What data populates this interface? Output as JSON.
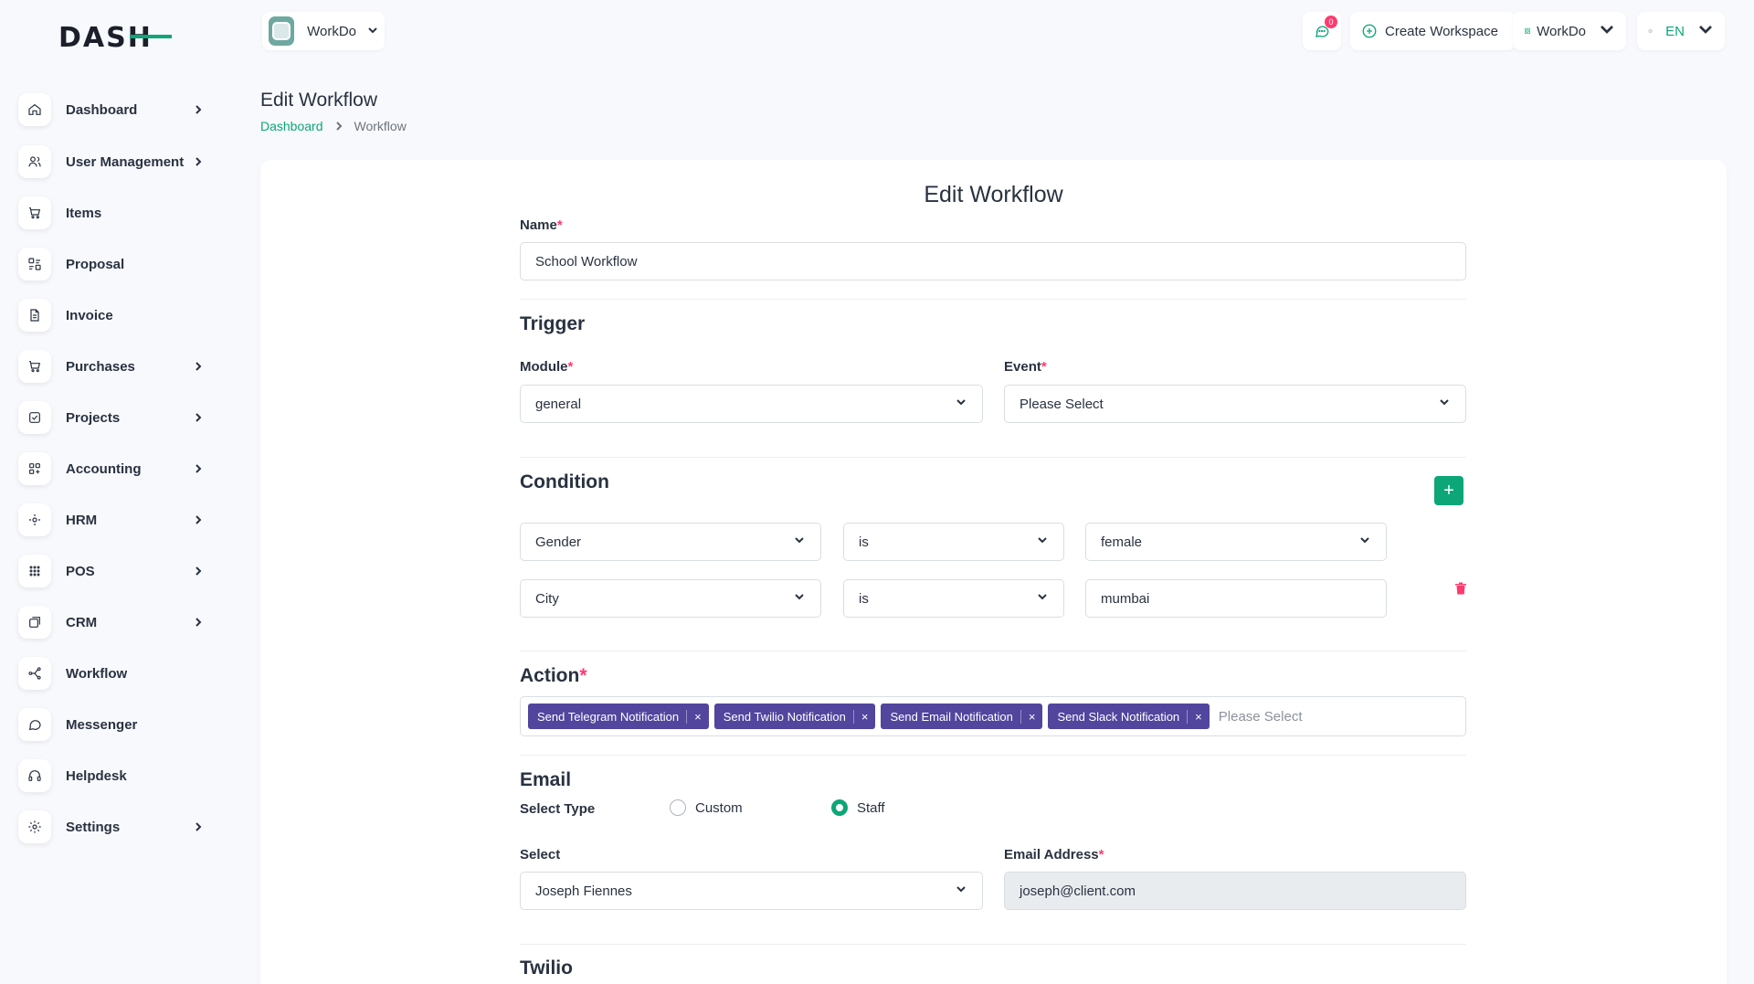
{
  "app": {
    "logo_text": "DASH",
    "accent_color": "#0ca678",
    "tag_color": "#51459d",
    "danger_color": "#ff3a6e"
  },
  "sidebar": {
    "items": [
      {
        "label": "Dashboard",
        "icon": "home-icon",
        "has_children": true
      },
      {
        "label": "User Management",
        "icon": "users-icon",
        "has_children": true
      },
      {
        "label": "Items",
        "icon": "cart-icon",
        "has_children": false
      },
      {
        "label": "Proposal",
        "icon": "proposal-icon",
        "has_children": false
      },
      {
        "label": "Invoice",
        "icon": "file-icon",
        "has_children": false
      },
      {
        "label": "Purchases",
        "icon": "cart-icon",
        "has_children": true
      },
      {
        "label": "Projects",
        "icon": "checkbox-icon",
        "has_children": true
      },
      {
        "label": "Accounting",
        "icon": "grid-icon",
        "has_children": true
      },
      {
        "label": "HRM",
        "icon": "hrm-icon",
        "has_children": true
      },
      {
        "label": "POS",
        "icon": "dots-grid-icon",
        "has_children": true
      },
      {
        "label": "CRM",
        "icon": "crm-icon",
        "has_children": true
      },
      {
        "label": "Workflow",
        "icon": "workflow-icon",
        "has_children": false
      },
      {
        "label": "Messenger",
        "icon": "chat-icon",
        "has_children": false
      },
      {
        "label": "Helpdesk",
        "icon": "headset-icon",
        "has_children": false
      },
      {
        "label": "Settings",
        "icon": "gear-icon",
        "has_children": true
      }
    ]
  },
  "header": {
    "workspace_name": "WorkDo",
    "notification_count": "0",
    "create_workspace_label": "Create Workspace",
    "user_workspace_label": "WorkDo",
    "language": "EN"
  },
  "page": {
    "title": "Edit Workflow",
    "breadcrumb": [
      "Dashboard",
      "Workflow"
    ]
  },
  "form": {
    "title": "Edit Workflow",
    "name_label": "Name",
    "name_value": "School Workflow",
    "trigger": {
      "heading": "Trigger",
      "module_label": "Module",
      "module_value": "general",
      "event_label": "Event",
      "event_value": "Please Select"
    },
    "condition": {
      "heading": "Condition",
      "add_label": "+",
      "rows": [
        {
          "field": "Gender",
          "operator": "is",
          "value": "female"
        },
        {
          "field": "City",
          "operator": "is",
          "value": "mumbai"
        }
      ]
    },
    "action": {
      "heading": "Action",
      "tags": [
        "Send Telegram Notification",
        "Send Twilio Notification",
        "Send Email Notification",
        "Send Slack Notification"
      ],
      "tag_remove": "×",
      "placeholder": "Please Select"
    },
    "email": {
      "heading": "Email",
      "select_type_label": "Select Type",
      "option_custom": "Custom",
      "option_staff": "Staff",
      "selected_option": "Staff",
      "select_label": "Select",
      "select_value": "Joseph Fiennes",
      "address_label": "Email Address",
      "address_value": "joseph@client.com"
    },
    "twilio": {
      "heading": "Twilio"
    }
  }
}
